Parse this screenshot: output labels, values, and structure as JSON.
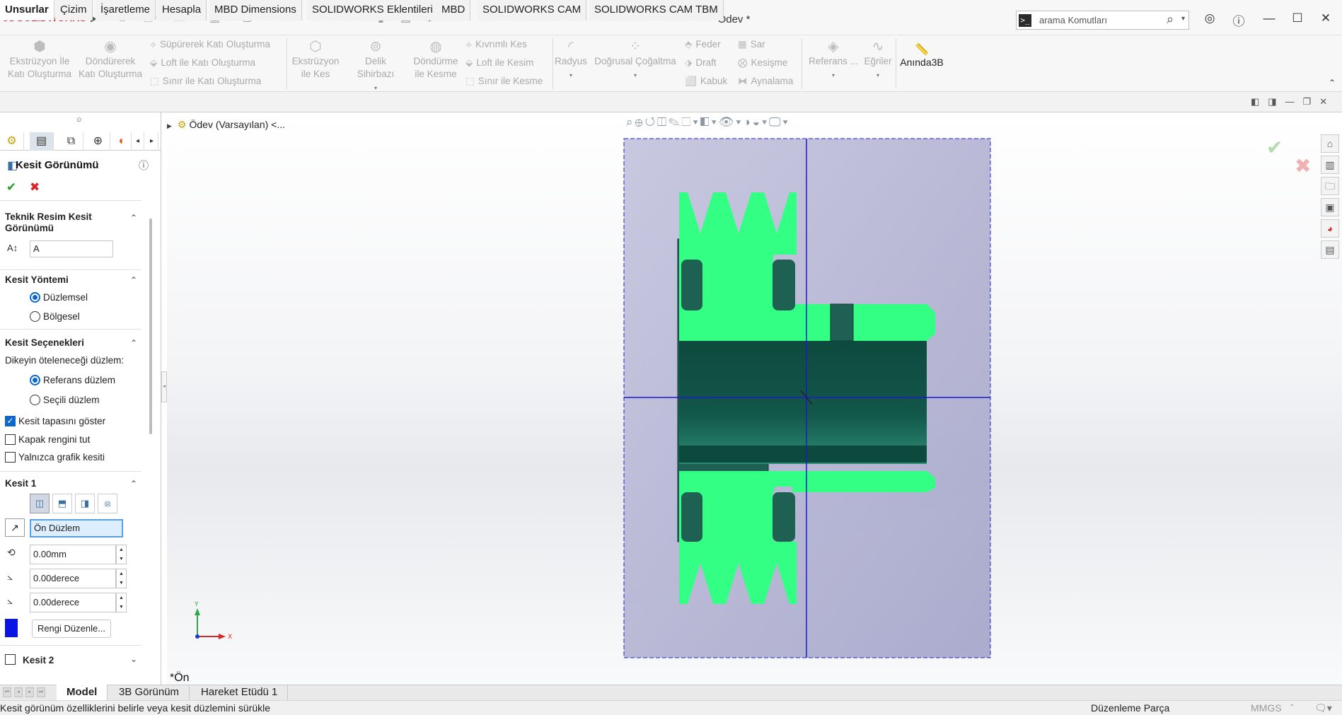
{
  "app": {
    "brand": "SOLIDWORKS",
    "doc_title": "Ödev *"
  },
  "search": {
    "placeholder": "arama Komutları"
  },
  "ribbon": {
    "extrude": "Ekstrüzyon İle Katı Oluşturma",
    "revolve": "Döndürerek Katı Oluşturma",
    "sweep": "Süpürerek Katı Oluşturma",
    "loft": "Loft ile Katı Oluşturma",
    "boundary": "Sınır ile Katı Oluşturma",
    "extrude_cut": "Ekstrüzyon ile Kes",
    "hole_wizard": "Delik Sihirbazı",
    "revolve_cut": "Döndürme ile Kesme",
    "swept_cut": "Kıvrımlı Kes",
    "loft_cut": "Loft ile Kesim",
    "boundary_cut": "Sınır ile Kesme",
    "fillet": "Radyus",
    "linear_pattern": "Doğrusal Çoğaltma",
    "rib": "Feder",
    "draft": "Draft",
    "shell": "Kabuk",
    "wrap": "Sar",
    "intersect": "Kesişme",
    "mirror": "Aynalama",
    "reference": "Referans ...",
    "curves": "Eğriler",
    "instant3d": "Anında3B"
  },
  "tabs": [
    "Unsurlar",
    "Çizim",
    "İşaretleme",
    "Hesapla",
    "MBD Dimensions",
    "SOLIDWORKS Eklentileri",
    "MBD",
    "SOLIDWORKS CAM",
    "SOLIDWORKS CAM TBM"
  ],
  "panel": {
    "title": "Kesit Görünümü",
    "s1_title": "Teknik Resim Kesit Görünümü",
    "label_value": "A",
    "s2_title": "Kesit Yöntemi",
    "method_planar": "Düzlemsel",
    "method_zonal": "Bölgesel",
    "s3_title": "Kesit Seçenekleri",
    "offset_label": "Dikeyin öteleneceği düzlem:",
    "ref_plane": "Referans düzlem",
    "sel_plane": "Seçili düzlem",
    "show_cap": "Kesit tapasını göster",
    "keep_cap_color": "Kapak rengini tut",
    "graphics_only": "Yalnızca grafik kesiti",
    "s4_title": "Kesit 1",
    "plane_value": "Ön Düzlem",
    "offset_value": "0.00mm",
    "angle_x": "0.00derece",
    "angle_y": "0.00derece",
    "edit_color": "Rengi Düzenle...",
    "s5_title": "Kesit 2",
    "cap_color": "#0a14e6"
  },
  "tree": {
    "root": "Ödev (Varsayılan) <..."
  },
  "viewport": {
    "view_label": "*Ön",
    "axis_x": "X",
    "axis_y": "Y"
  },
  "bottom_tabs": [
    "Model",
    "3B Görünüm",
    "Hareket Etüdü 1"
  ],
  "status": {
    "message": "Kesit görünüm özelliklerini belirle veya kesit düzlemini sürükle",
    "mode": "Düzenleme Parça",
    "units": "MMGS"
  }
}
